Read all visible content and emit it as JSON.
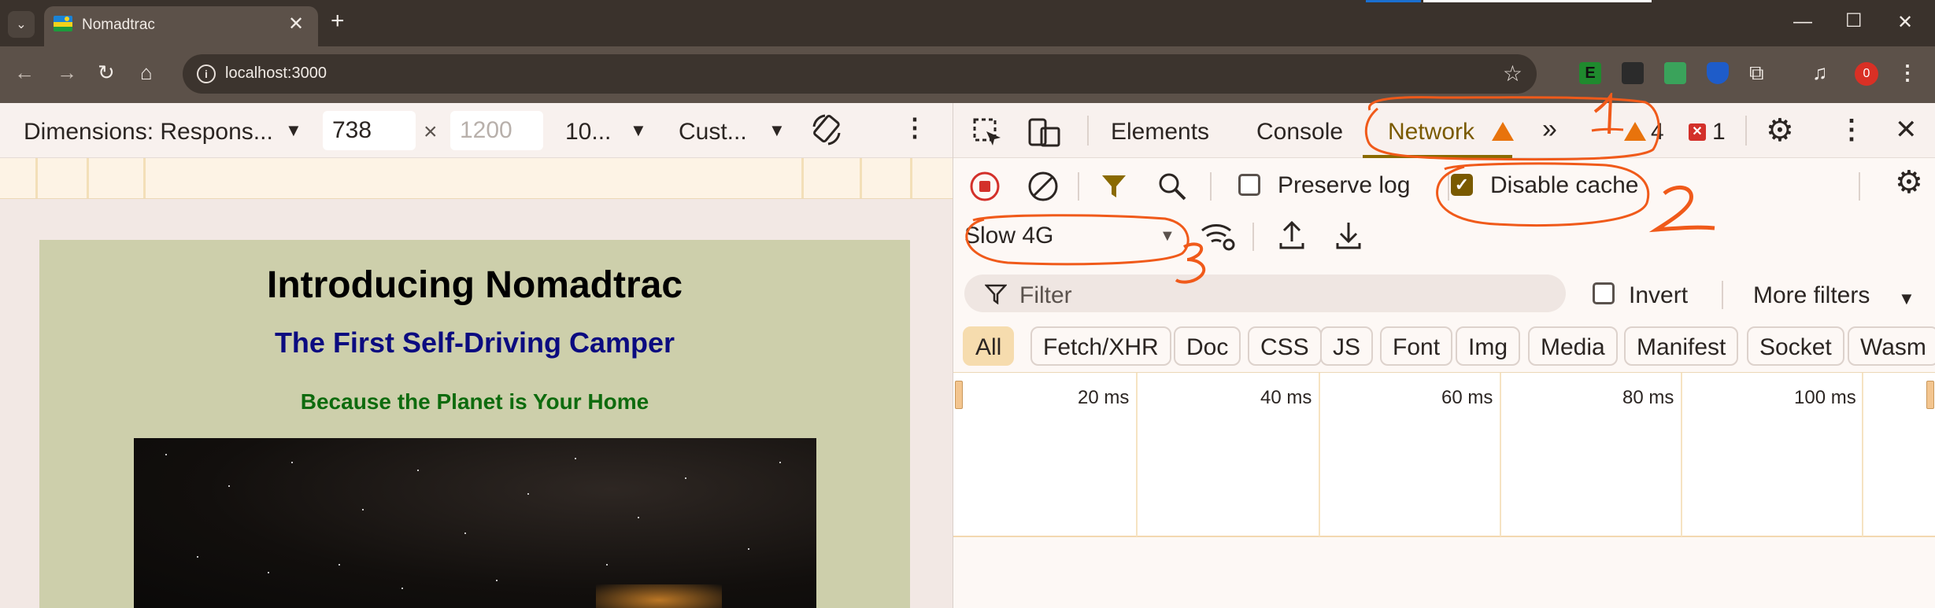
{
  "browser": {
    "tab_title": "Nomadtrac",
    "url": "localhost:3000",
    "profile_badge": "0"
  },
  "device_toolbar": {
    "dimensions_label": "Dimensions: Respons...",
    "width_value": "738",
    "height_placeholder": "1200",
    "zoom_label": "10...",
    "throttle_label": "Cust..."
  },
  "page": {
    "title": "Introducing Nomadtrac",
    "subtitle": "The First Self-Driving Camper",
    "tagline": "Because the Planet is Your Home"
  },
  "devtools": {
    "tabs": [
      {
        "label": "Elements"
      },
      {
        "label": "Console"
      },
      {
        "label": "Network"
      }
    ],
    "warning_count": "4",
    "error_count": "1",
    "preserve_log_label": "Preserve log",
    "disable_cache_label": "Disable cache",
    "disable_cache_checked": true,
    "throttling_value": "Slow 4G",
    "filter_placeholder": "Filter",
    "invert_label": "Invert",
    "more_filters_label": "More filters",
    "filter_chips": [
      "All",
      "Fetch/XHR",
      "Doc",
      "CSS",
      "JS",
      "Font",
      "Img",
      "Media",
      "Manifest",
      "Socket",
      "Wasm"
    ],
    "timeline_labels": [
      "20 ms",
      "40 ms",
      "60 ms",
      "80 ms",
      "100 ms"
    ]
  },
  "annotations": [
    "1",
    "2",
    "3"
  ],
  "colors": {
    "annotation": "#f05a1a",
    "active_tab": "#7a5a00",
    "warning": "#e8730c",
    "error": "#d3302a",
    "page_bg": "#cdcfab",
    "subtitle": "#0b0b80",
    "tagline": "#0e6b0e"
  }
}
